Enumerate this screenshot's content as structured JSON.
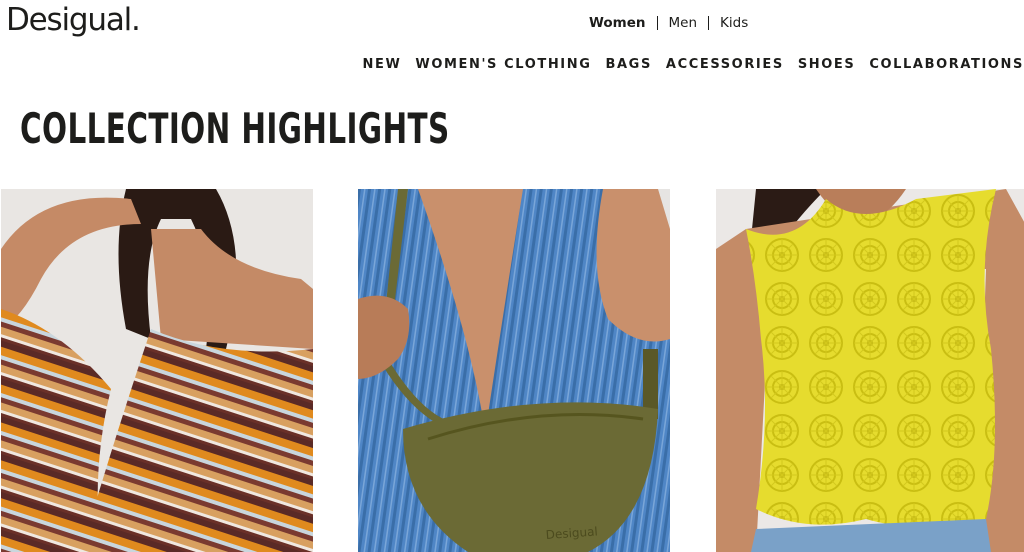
{
  "brand": {
    "logo_text": "Desigual."
  },
  "gender_nav": {
    "items": [
      {
        "label": "Women",
        "active": true
      },
      {
        "label": "Men",
        "active": false
      },
      {
        "label": "Kids",
        "active": false
      }
    ]
  },
  "main_nav": {
    "items": [
      {
        "label": "NEW"
      },
      {
        "label": "WOMEN'S CLOTHING"
      },
      {
        "label": "BAGS"
      },
      {
        "label": "ACCESSORIES"
      },
      {
        "label": "SHOES"
      },
      {
        "label": "COLLABORATIONS"
      }
    ]
  },
  "page": {
    "title": "COLLECTION HIGHLIGHTS"
  },
  "products": [
    {
      "image": "model-striped-knit-dress"
    },
    {
      "image": "model-denim-vest-green-crossbody-bag",
      "bag_logo": "Desigual"
    },
    {
      "image": "model-yellow-crochet-top"
    }
  ],
  "colors": {
    "text": "#1d1d1b",
    "background": "#ffffff",
    "bag_olive": "#6b6a35",
    "denim_blue": "#4f86c6",
    "crochet_yellow": "#e6dc2e",
    "stripe_orange": "#e08a1e",
    "stripe_brown": "#5a2a26"
  }
}
